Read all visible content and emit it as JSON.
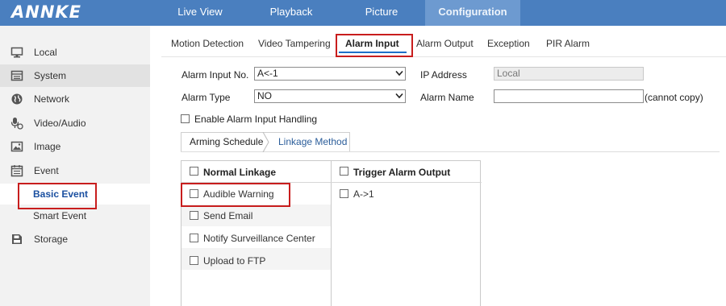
{
  "brand": {
    "logo_text": "ANNKE"
  },
  "nav": {
    "items": [
      {
        "label": "Live View"
      },
      {
        "label": "Playback"
      },
      {
        "label": "Picture"
      },
      {
        "label": "Configuration"
      }
    ],
    "active": "Configuration"
  },
  "sidebar": {
    "items": [
      {
        "label": "Local",
        "icon": "monitor-icon"
      },
      {
        "label": "System",
        "icon": "system-icon"
      },
      {
        "label": "Network",
        "icon": "globe-icon"
      },
      {
        "label": "Video/Audio",
        "icon": "microphone-icon"
      },
      {
        "label": "Image",
        "icon": "image-icon"
      },
      {
        "label": "Event",
        "icon": "calendar-icon"
      },
      {
        "label": "Storage",
        "icon": "storage-icon"
      }
    ],
    "event_sub": [
      {
        "label": "Basic Event"
      },
      {
        "label": "Smart Event"
      }
    ],
    "active_sub": "Basic Event"
  },
  "tabs": {
    "items": [
      {
        "label": "Motion Detection"
      },
      {
        "label": "Video Tampering"
      },
      {
        "label": "Alarm Input"
      },
      {
        "label": "Alarm Output"
      },
      {
        "label": "Exception"
      },
      {
        "label": "PIR Alarm"
      }
    ],
    "active": "Alarm Input"
  },
  "form": {
    "alarm_input_no_label": "Alarm Input No.",
    "alarm_input_no_value": "A<-1",
    "ip_address_label": "IP Address",
    "ip_address_value": "Local",
    "alarm_type_label": "Alarm Type",
    "alarm_type_value": "NO",
    "alarm_name_label": "Alarm Name",
    "alarm_name_value": "",
    "alarm_name_hint": "(cannot copy)",
    "enable_label": "Enable Alarm Input Handling",
    "enable_checked": false
  },
  "subtabs": {
    "items": [
      {
        "label": "Arming Schedule"
      },
      {
        "label": "Linkage Method"
      }
    ],
    "active": "Linkage Method"
  },
  "linkage": {
    "normal_header": "Normal Linkage",
    "normal_items": [
      {
        "label": "Audible Warning",
        "checked": false
      },
      {
        "label": "Send Email",
        "checked": false
      },
      {
        "label": "Notify Surveillance Center",
        "checked": false
      },
      {
        "label": "Upload to FTP",
        "checked": false
      }
    ],
    "trigger_header": "Trigger Alarm Output",
    "trigger_items": [
      {
        "label": "A->1",
        "checked": false
      }
    ]
  },
  "colors": {
    "topbar": "#4a7fbf",
    "active_nav": "#6d9ad0",
    "highlight_box": "#c81d1d",
    "active_link": "#1a4fa0"
  }
}
